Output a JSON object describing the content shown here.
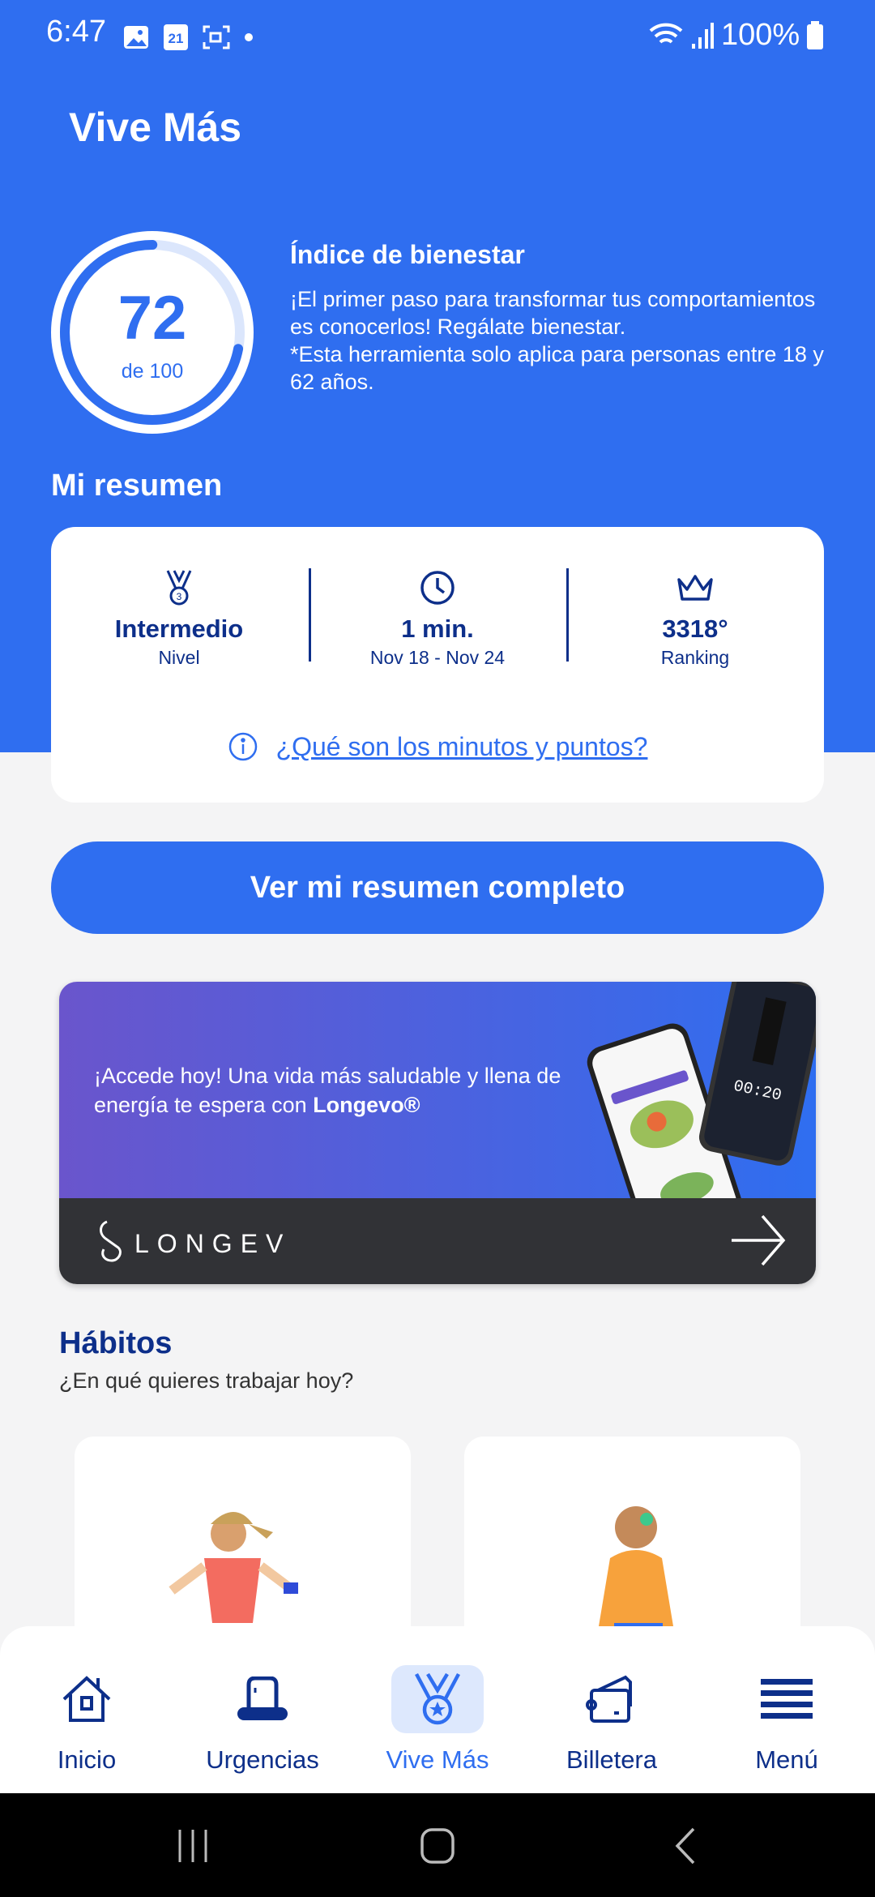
{
  "status_bar": {
    "time": "6:47",
    "calendar_day": "21",
    "battery": "100%"
  },
  "header": {
    "title": "Vive Más"
  },
  "wellness": {
    "score": "72",
    "score_value": 72,
    "max_label": "de 100",
    "title": "Índice de bienestar",
    "description": "¡El primer paso para transformar tus comportamientos es conocerlos! Regálate bienestar.",
    "note": "*Esta herramienta solo aplica para personas entre 18 y 62 años."
  },
  "summary": {
    "title": "Mi resumen",
    "stats": [
      {
        "icon": "medal-icon",
        "value": "Intermedio",
        "label": "Nivel"
      },
      {
        "icon": "clock-icon",
        "value": "1 min.",
        "label": "Nov 18 - Nov 24"
      },
      {
        "icon": "crown-icon",
        "value": "3318°",
        "label": "Ranking"
      }
    ],
    "info_link": "¿Qué son los minutos y puntos?"
  },
  "full_summary_button": "Ver mi resumen completo",
  "banner": {
    "text": "¡Accede hoy! Una vida más saludable y llena de energía te espera con ",
    "brand": "Longevo®",
    "logo_text": "LONGEVO",
    "phone_timer": "00:20"
  },
  "habits": {
    "title": "Hábitos",
    "subtitle": "¿En qué quieres trabajar hoy?"
  },
  "bottom_nav": {
    "active": "Vive Más",
    "items": [
      {
        "label": "Inicio",
        "icon": "home-icon"
      },
      {
        "label": "Urgencias",
        "icon": "siren-icon"
      },
      {
        "label": "Vive Más",
        "icon": "medal-icon"
      },
      {
        "label": "Billetera",
        "icon": "wallet-icon"
      },
      {
        "label": "Menú",
        "icon": "menu-icon"
      }
    ]
  },
  "colors": {
    "primary": "#2f6ef0",
    "navy": "#0d2f8a",
    "banner_dark": "#313236"
  }
}
